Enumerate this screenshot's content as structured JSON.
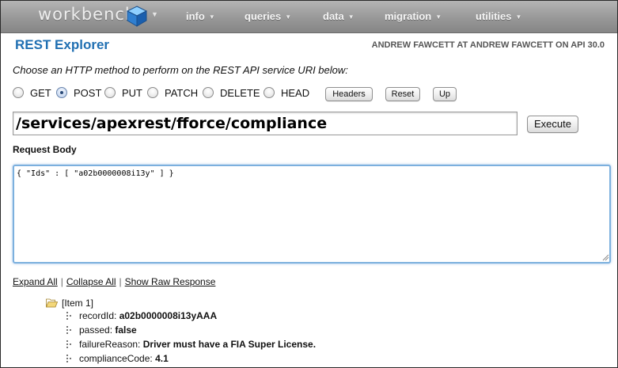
{
  "nav": {
    "brand": "workbench",
    "menu": [
      "info",
      "queries",
      "data",
      "migration",
      "utilities"
    ]
  },
  "header": {
    "title": "REST Explorer",
    "user": "ANDREW FAWCETT AT ANDREW FAWCETT ON API 30.0"
  },
  "instruction": "Choose an HTTP method to perform on the REST API service URI below:",
  "methods": {
    "options": [
      "GET",
      "POST",
      "PUT",
      "PATCH",
      "DELETE",
      "HEAD"
    ],
    "selected": "POST"
  },
  "buttons": {
    "headers": "Headers",
    "reset": "Reset",
    "up": "Up",
    "execute": "Execute"
  },
  "uri": "/services/apexrest/fforce/compliance",
  "request": {
    "label": "Request Body",
    "body": "{ \"Ids\" : [ \"a02b0000008i13y\" ] }"
  },
  "links": {
    "expand_all": "Expand All",
    "separator": "|",
    "collapse_all": "Collapse All",
    "show_raw": "Show Raw Response"
  },
  "result": {
    "item_label": "[Item 1]",
    "fields": [
      {
        "key": "recordId:",
        "value": "a02b0000008i13yAAA"
      },
      {
        "key": "passed:",
        "value": "false"
      },
      {
        "key": "failureReason:",
        "value": "Driver must have a FIA Super License."
      },
      {
        "key": "complianceCode:",
        "value": "4.1"
      }
    ]
  },
  "colors": {
    "accent": "#1f6fb2",
    "navbar": "#9a9a9a",
    "focus_border": "#7cb0de"
  },
  "icons": {
    "brand": "cube-icon",
    "folder": "folder-open-icon",
    "leaf": "tree-leaf-icon"
  }
}
